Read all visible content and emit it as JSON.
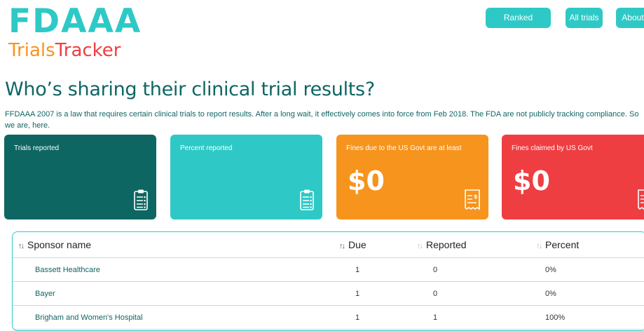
{
  "logo": {
    "top": "FDAAA",
    "bottom_trials": "Trials",
    "bottom_tracker": "Tracker"
  },
  "nav": {
    "ranked": "Ranked sponsors",
    "all": "All trials",
    "about": "About"
  },
  "title": "Who’s sharing their clinical trial results?",
  "intro": "FFDAAA 2007 is a law that requires certain clinical trials to report results. After a long wait, it effectively comes into force from Feb 2018. The FDA are not publicly tracking compliance. So we are, here.",
  "cards": [
    {
      "label": "Trials reported",
      "value": "",
      "color": "#0e6663",
      "icon": "clipboard-icon"
    },
    {
      "label": "Percent reported",
      "value": "",
      "color": "#2ec9c6",
      "icon": "clipboard-icon"
    },
    {
      "label": "Fines due to the US Govt are at least",
      "value": "$0",
      "color": "#f7941d",
      "icon": "receipt-icon"
    },
    {
      "label": "Fines claimed by US Govt",
      "value": "$0",
      "color": "#ef3e42",
      "icon": "receipt-icon"
    }
  ],
  "table": {
    "headers": {
      "sponsor": "Sponsor name",
      "due": "Due",
      "reported": "Reported",
      "percent": "Percent"
    },
    "rows": [
      {
        "name": "Bassett Healthcare",
        "due": "1",
        "reported": "0",
        "percent": "0%"
      },
      {
        "name": "Bayer",
        "due": "1",
        "reported": "0",
        "percent": "0%"
      },
      {
        "name": "Brigham and Women's Hospital",
        "due": "1",
        "reported": "1",
        "percent": "100%"
      }
    ]
  }
}
